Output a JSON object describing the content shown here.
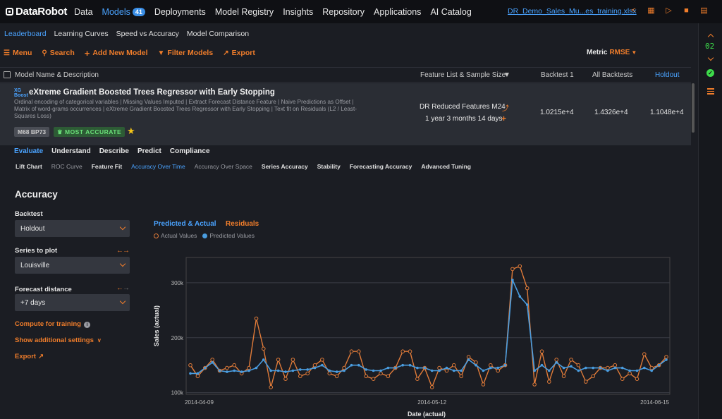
{
  "nav": {
    "brand": "DataRobot",
    "items": [
      {
        "label": "Data"
      },
      {
        "label": "Models",
        "badge": "41",
        "active": true
      },
      {
        "label": "Deployments"
      },
      {
        "label": "Model Registry"
      },
      {
        "label": "Insights"
      },
      {
        "label": "Repository"
      },
      {
        "label": "Applications"
      },
      {
        "label": "AI Catalog"
      }
    ],
    "file_name": "DR_Demo_Sales_Mu...es_training.xlsx",
    "icons": [
      "share-icon",
      "document-icon",
      "megaphone-icon",
      "folder-icon",
      "folder-open-icon"
    ]
  },
  "rail": {
    "timer": "02"
  },
  "subnav": [
    "Leaderboard",
    "Learning Curves",
    "Speed vs Accuracy",
    "Model Comparison"
  ],
  "toolbar": {
    "menu": "Menu",
    "search": "Search",
    "add_model": "Add New Model",
    "filter": "Filter Models",
    "export": "Export",
    "metric_label": "Metric",
    "metric_value": "RMSE"
  },
  "table_header": {
    "name": "Model Name & Description",
    "feature_list": "Feature List & Sample Size",
    "backtest1": "Backtest 1",
    "all_backtests": "All Backtests",
    "holdout": "Holdout"
  },
  "model": {
    "icon_text": "XG Boost",
    "title": "eXtreme Gradient Boosted Trees Regressor with Early Stopping",
    "description": "Ordinal encoding of categorical variables | Missing Values Imputed | Extract Forecast Distance Feature | Naive Predictions as Offset | Matrix of word-grams occurrences | eXtreme Gradient Boosted Trees Regressor with Early Stopping | Text fit on Residuals (L2 / Least-Squares Loss)",
    "ids": "M68  BP73",
    "badge": "MOST ACCURATE",
    "feature_list": "DR Reduced Features M24",
    "sample_size": "1 year 3 months 14 days",
    "backtest1": "1.0215e+4",
    "all_backtests": "1.4326e+4",
    "holdout": "1.1048e+4"
  },
  "eval_tabs": [
    "Evaluate",
    "Understand",
    "Describe",
    "Predict",
    "Compliance"
  ],
  "insight_tabs": [
    "Lift Chart",
    "ROC Curve",
    "Feature Fit",
    "Accuracy Over Time",
    "Accuracy Over Space",
    "Series Accuracy",
    "Stability",
    "Forecasting Accuracy",
    "Advanced Tuning"
  ],
  "settings": {
    "title": "Accuracy",
    "backtest_label": "Backtest",
    "backtest_value": "Holdout",
    "series_label": "Series to plot",
    "series_value": "Louisville",
    "forecast_label": "Forecast distance",
    "forecast_value": "+7 days",
    "compute": "Compute for training",
    "additional": "Show additional settings",
    "export": "Export"
  },
  "chart_tabs": {
    "predicted": "Predicted & Actual",
    "residuals": "Residuals"
  },
  "colors": {
    "accent": "#f07d2b",
    "link": "#4aa3ff",
    "actual": "#e07b39",
    "predicted": "#4a9de0"
  },
  "chart_data": {
    "type": "line",
    "xlabel": "Date (actual)",
    "ylabel": "Sales (actual)",
    "x_tick_labels": [
      "2014-04-09",
      "2014-05-12",
      "2014-06-15"
    ],
    "y_tick_labels": [
      "100k",
      "200k",
      "300k"
    ],
    "ylim": [
      97000,
      346000
    ],
    "x_start": "2014-04-09",
    "x_end": "2014-06-15",
    "grid": true,
    "legend_position": "top-left",
    "series": [
      {
        "name": "Actual Values",
        "values": [
          150000,
          130000,
          145000,
          160000,
          140000,
          145000,
          150000,
          135000,
          145000,
          235000,
          180000,
          110000,
          160000,
          125000,
          160000,
          130000,
          135000,
          150000,
          160000,
          135000,
          130000,
          145000,
          175000,
          175000,
          130000,
          125000,
          135000,
          130000,
          145000,
          175000,
          175000,
          125000,
          145000,
          110000,
          145000,
          140000,
          150000,
          130000,
          165000,
          155000,
          115000,
          150000,
          140000,
          150000,
          325000,
          330000,
          290000,
          115000,
          175000,
          120000,
          160000,
          130000,
          160000,
          150000,
          120000,
          130000,
          145000,
          145000,
          150000,
          125000,
          135000,
          125000,
          170000,
          145000,
          150000,
          165000
        ]
      },
      {
        "name": "Predicted Values",
        "values": [
          135000,
          135000,
          145000,
          155000,
          140000,
          138000,
          140000,
          138000,
          140000,
          145000,
          160000,
          140000,
          140000,
          138000,
          140000,
          142000,
          142000,
          145000,
          150000,
          140000,
          138000,
          140000,
          150000,
          150000,
          142000,
          140000,
          140000,
          145000,
          145000,
          150000,
          150000,
          145000,
          145000,
          140000,
          140000,
          145000,
          140000,
          140000,
          160000,
          150000,
          140000,
          145000,
          145000,
          150000,
          305000,
          275000,
          260000,
          140000,
          150000,
          140000,
          155000,
          145000,
          148000,
          140000,
          145000,
          145000,
          145000,
          140000,
          145000,
          145000,
          140000,
          140000,
          145000,
          140000,
          150000,
          160000
        ]
      }
    ]
  }
}
